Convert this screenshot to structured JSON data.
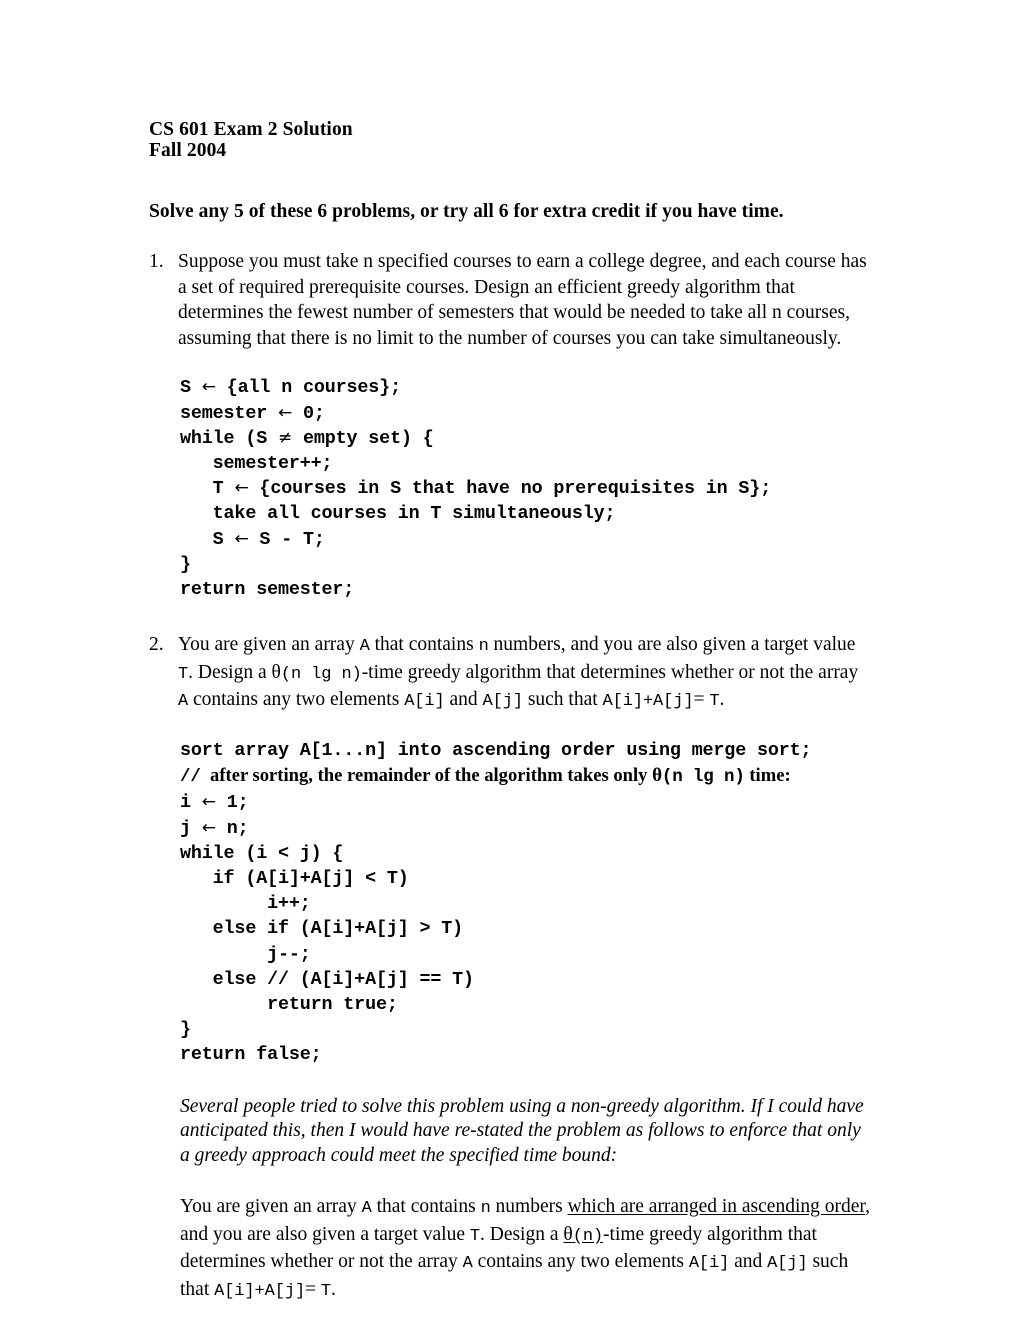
{
  "document": {
    "title": "CS 601 Exam 2 Solution",
    "term": "Fall 2004",
    "instruction": "Solve any 5 of these 6 problems, or try all 6 for extra credit if you have time."
  },
  "problems": [
    {
      "number": "1.",
      "statement": "Suppose you must take n specified courses to earn a college degree, and each course has a set of required prerequisite courses.  Design an efficient greedy algorithm that determines the fewest number of semesters that would be needed to take all n courses, assuming that there is no limit to the number of courses you can take simultaneously.",
      "code_lines": [
        "S ← {all n courses};",
        "semester ← 0;",
        "while (S ≠ empty set) {",
        "   semester++;",
        "   T ← {courses in S that have no prerequisites in S};",
        "   take all courses in T simultaneously;",
        "   S ← S - T;",
        "}",
        "return semester;"
      ]
    },
    {
      "number": "2.",
      "statement_parts": {
        "p1": "You are given an array ",
        "c1": "A",
        "p2": " that contains ",
        "c2": "n",
        "p3": " numbers, and you are also given a target value ",
        "c3": "T",
        "p4": ".  Design a ",
        "theta": "θ",
        "c4": "(n lg n)",
        "p5": "-time greedy algorithm that determines whether or not the array ",
        "c5": "A",
        "p6": " contains any two elements ",
        "c6": "A[i]",
        "p7": " and ",
        "c7": "A[j]",
        "p8": " such that ",
        "c8": "A[i]+A[j]",
        "p9": "= ",
        "c9": "T",
        "p10": "."
      },
      "code_lines": [
        "sort array A[1...n] into ascending order using merge sort;",
        "i ← 1;",
        "j ← n;",
        "while (i < j) {",
        "   if (A[i]+A[j] < T)",
        "        i++;",
        "   else if (A[i]+A[j] > T)",
        "        j--;",
        "   else // (A[i]+A[j] == T)",
        "        return true;",
        "}",
        "return false;"
      ],
      "comment_line": {
        "slashes": "//",
        "text_before_theta": "  after sorting, the remainder of the algorithm takes only ",
        "theta": "θ",
        "mono": "(n lg n)",
        "text_after": " time:"
      },
      "note": "Several people tried to solve this problem using a non-greedy algorithm.  If I could have anticipated this, then I would have re-stated the problem as follows to enforce that only a greedy approach could meet the specified time bound:",
      "restated_parts": {
        "r1": "You are given an array ",
        "rc1": "A",
        "r2": " that contains ",
        "rc2": "n",
        "r3": " numbers ",
        "ru1": "which are arranged in ascending order",
        "r4": ", and you are also given a target value ",
        "rc3": "T",
        "r5": ".  Design a ",
        "ru2_theta": "θ",
        "ru2_mono": "(n)",
        "r6": "-time greedy algorithm that determines whether or not the array ",
        "rc4": "A",
        "r7": " contains any two elements ",
        "rc5": "A[i]",
        "r8": " and ",
        "rc6": "A[j]",
        "r9": " such that ",
        "rc7": "A[i]+A[j]",
        "r10": "= ",
        "rc8": "T",
        "r11": "."
      }
    }
  ],
  "colors": {
    "page_background": "#ffffff",
    "text": "#000000"
  }
}
